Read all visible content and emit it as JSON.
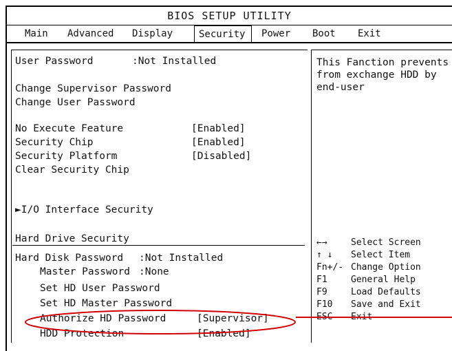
{
  "title": "BIOS SETUP UTILITY",
  "menu": [
    "Main",
    "Advanced",
    "Display",
    "Security",
    "Power",
    "Boot",
    "Exit"
  ],
  "active_menu": "Security",
  "items": {
    "user_password_label": "User Password",
    "user_password_value": ":Not Installed",
    "change_supervisor": "Change Supervisor Password",
    "change_user": "Change User Password",
    "nx_label": "No Execute Feature",
    "nx_value": "[Enabled]",
    "chip_label": "Security Chip",
    "chip_value": "[Enabled]",
    "platform_label": "Security Platform",
    "platform_value": "[Disabled]",
    "clear_chip": "Clear Security Chip",
    "io_security": "►I/O Interface Security",
    "hd_section": "Hard Drive Security",
    "hd_password_label": "Hard Disk Password",
    "hd_password_value": ":Not Installed",
    "master_label": "Master Password",
    "master_value": ":None",
    "set_hd_user": "Set HD User Password",
    "set_hd_master": "Set HD Master Password",
    "authorize_label": "Authorize HD Password",
    "authorize_value": "[Supervisor]",
    "hdd_protection_label": "HDD Protection",
    "hdd_protection_value": "[Enabled]"
  },
  "help_text": [
    "This Fanction prevents",
    "from exchange HDD by",
    "end-user"
  ],
  "keys": [
    {
      "key": "←→",
      "desc": "Select Screen"
    },
    {
      "key": "↑ ↓",
      "desc": "Select Item"
    },
    {
      "key": "Fn+/-",
      "desc": "Change Option"
    },
    {
      "key": "F1",
      "desc": "General Help"
    },
    {
      "key": "F9",
      "desc": "Load Defaults"
    },
    {
      "key": "F10",
      "desc": "Save and Exit"
    },
    {
      "key": "ESC",
      "desc": "Exit"
    }
  ],
  "colors": {
    "highlight": "#d00000"
  }
}
